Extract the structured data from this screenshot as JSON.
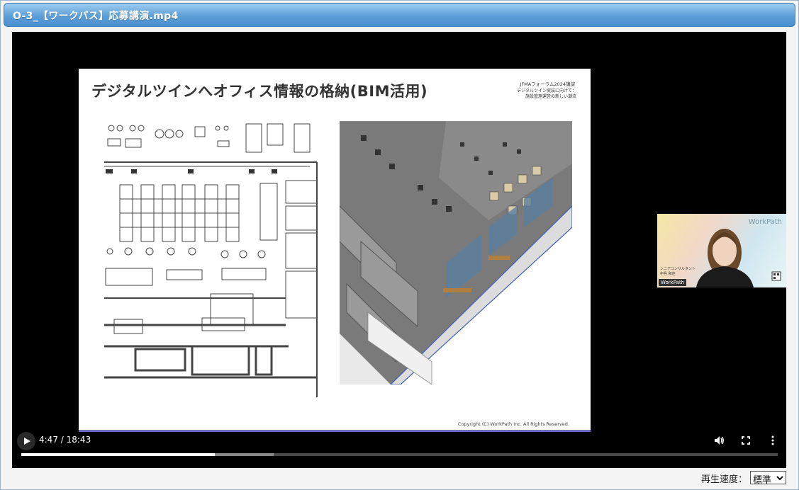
{
  "window": {
    "title": "O-3_【ワークパス】応募講演.mp4"
  },
  "slide": {
    "title": "デジタルツインへオフィス情報の格納(BIM活用)",
    "event": "JFMAフォーラム2024講演",
    "subtitle_lines": [
      "デジタルツイン実装に向けて：",
      "施設管理運営の新しい潮流"
    ],
    "copyright": "Copyright (C) WorkPath Inc. All Rights Reserved."
  },
  "webcam": {
    "logo": "WorkPath",
    "tag": "WorkPath",
    "name_lines": [
      "シニアコンサルタント",
      "中島 和佳"
    ]
  },
  "controls": {
    "time": "4:47 / 18:43",
    "progress_fraction": 0.2556,
    "buffered_fraction": 0.334,
    "icons": [
      "play-icon",
      "volume-icon",
      "fullscreen-icon",
      "more-vert-icon"
    ]
  },
  "speed": {
    "label": "再生速度：",
    "value": "標準"
  },
  "colors": {
    "titlebar": "#5c9fd8",
    "slide_accent": "#6b6fb8"
  }
}
